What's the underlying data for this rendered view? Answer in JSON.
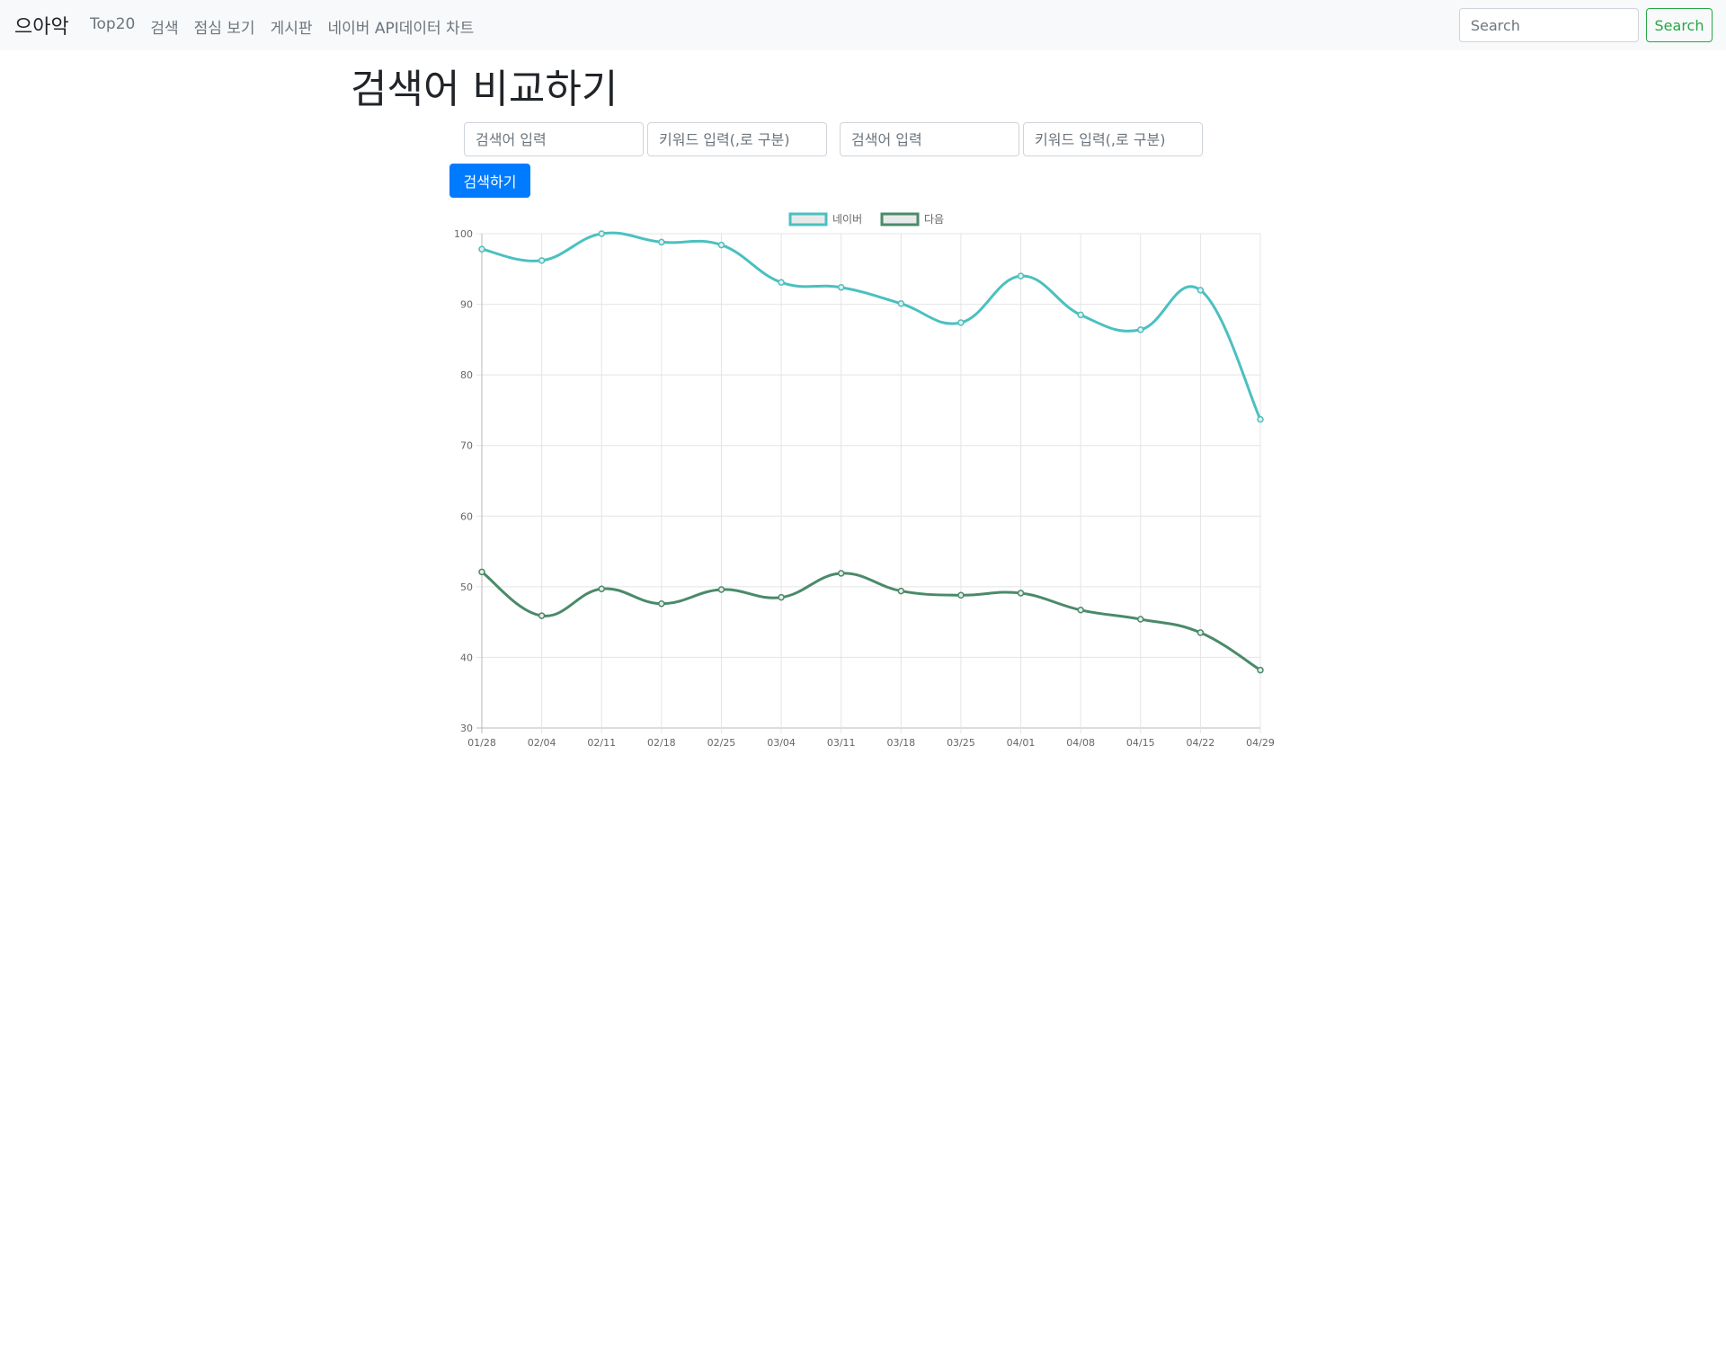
{
  "navbar": {
    "brand": "으아악",
    "links": [
      "Top20",
      "검색",
      "점심 보기",
      "게시판",
      "네이버 API데이터 차트"
    ],
    "search_placeholder": "Search",
    "search_button": "Search",
    "search_button_color": "#28a745"
  },
  "page": {
    "title": "검색어 비교하기",
    "inputs": [
      {
        "placeholder": "검색어 입력",
        "value": ""
      },
      {
        "placeholder": "키워드 입력(,로 구분)",
        "value": ""
      },
      {
        "placeholder": "검색어 입력",
        "value": ""
      },
      {
        "placeholder": "키워드 입력(,로 구분)",
        "value": ""
      }
    ],
    "submit_button": "검색하기",
    "submit_button_color": "#007bff"
  },
  "chart_data": {
    "type": "line",
    "categories": [
      "01/28",
      "02/04",
      "02/11",
      "02/18",
      "02/25",
      "03/04",
      "03/11",
      "03/18",
      "03/25",
      "04/01",
      "04/08",
      "04/15",
      "04/22",
      "04/29"
    ],
    "ylim": [
      30,
      100
    ],
    "yticks": [
      30,
      40,
      50,
      60,
      70,
      80,
      90,
      100
    ],
    "grid": true,
    "legend_position": "top",
    "series": [
      {
        "name": "네이버",
        "color": "#4bc0c0",
        "values": [
          97.8,
          96.2,
          100,
          98.8,
          98.4,
          93.1,
          92.4,
          90.1,
          87.4,
          94.0,
          88.5,
          86.4,
          92.0,
          73.7
        ]
      },
      {
        "name": "다음",
        "color": "#4a8a6a",
        "values": [
          52.1,
          45.9,
          49.7,
          47.6,
          49.6,
          48.5,
          51.9,
          49.4,
          48.8,
          49.1,
          46.7,
          45.4,
          43.5,
          38.2
        ]
      }
    ]
  }
}
